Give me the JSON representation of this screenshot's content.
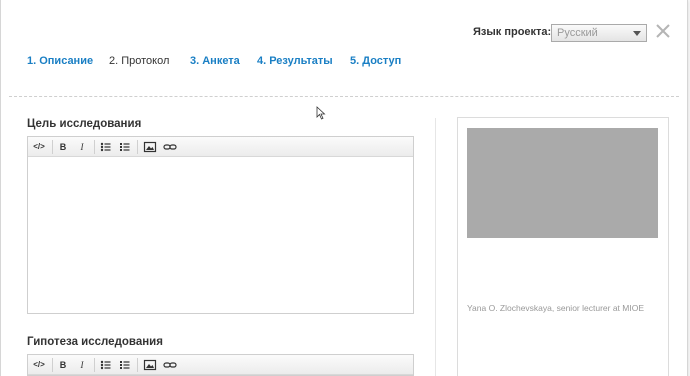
{
  "header": {
    "lang_label": "Язык проекта:",
    "lang_value": "Русский",
    "close_icon": "close-icon"
  },
  "tabs": [
    {
      "label": "1. Описание",
      "active": false
    },
    {
      "label": "2. Протокол",
      "active": true
    },
    {
      "label": "3. Анкета",
      "active": false
    },
    {
      "label": "4. Результаты",
      "active": false
    },
    {
      "label": "5. Доступ",
      "active": false
    }
  ],
  "sections": [
    {
      "title": "Цель исследования"
    },
    {
      "title": "Гипотеза исследования"
    }
  ],
  "toolbar": {
    "source": "</>",
    "bold": "B",
    "italic": "I",
    "icons": [
      "code-icon",
      "bold-icon",
      "italic-icon",
      "bulleted-list-icon",
      "numbered-list-icon",
      "image-icon",
      "link-icon"
    ]
  },
  "sidebar": {
    "caption": "Yana O. Zlochevskaya, senior lecturer at MIOE"
  },
  "colors": {
    "link": "#1a7fc4",
    "text": "#333333",
    "photo_placeholder": "#aaaaaa"
  }
}
